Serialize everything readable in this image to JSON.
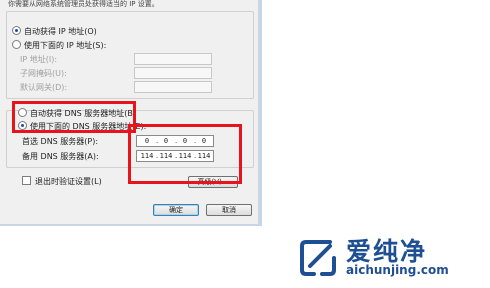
{
  "dialog": {
    "top_text": "你需要从网络系统管理员处获得适当的 IP 设置。",
    "ip_section": {
      "auto_label": "自动获得 IP 地址(O)",
      "auto_selected": true,
      "manual_label": "使用下面的 IP 地址(S):",
      "ip_label": "IP 地址(I):",
      "mask_label": "子网掩码(U):",
      "gateway_label": "默认网关(D):"
    },
    "dns_section": {
      "auto_label": "自动获得 DNS 服务器地址(B)",
      "manual_label": "使用下面的 DNS 服务器地址(E):",
      "manual_selected": true,
      "preferred_label": "首选 DNS 服务器(P):",
      "preferred_value": [
        "0",
        "0",
        "0",
        "0"
      ],
      "alternate_label": "备用 DNS 服务器(A):",
      "alternate_value": [
        "114",
        "114",
        "114",
        "114"
      ]
    },
    "validate_label": "退出时验证设置(L)",
    "advanced_label": "高级(V)...",
    "ok_label": "确定",
    "cancel_label": "取消"
  },
  "watermark": {
    "cn": "爱纯净",
    "en": "aichunjing.com"
  },
  "colors": {
    "highlight": "#e8141b",
    "brand": "#1e4f93"
  }
}
